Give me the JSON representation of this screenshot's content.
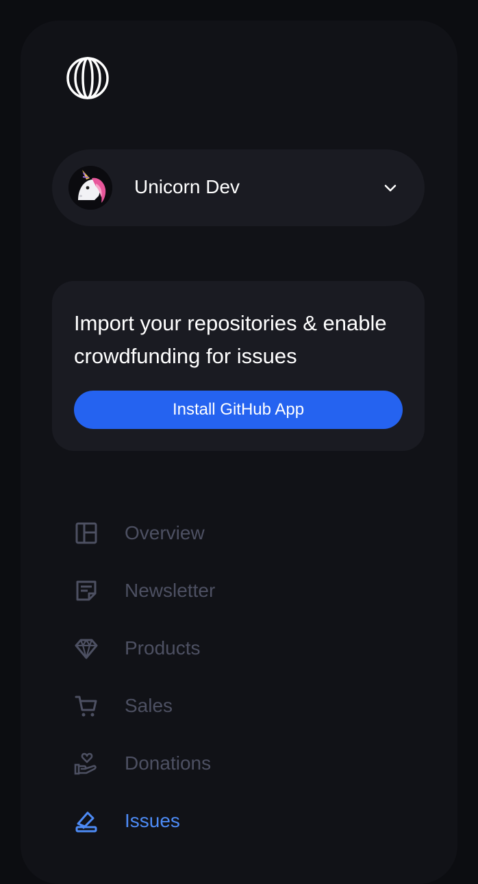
{
  "account": {
    "name": "Unicorn Dev",
    "avatar_icon": "unicorn-icon"
  },
  "promo": {
    "text": "Import your repositories & enable crowdfunding for issues",
    "button_label": "Install GitHub App"
  },
  "nav": {
    "items": [
      {
        "label": "Overview",
        "icon": "layout-icon",
        "active": false
      },
      {
        "label": "Newsletter",
        "icon": "newsletter-icon",
        "active": false
      },
      {
        "label": "Products",
        "icon": "diamond-icon",
        "active": false
      },
      {
        "label": "Sales",
        "icon": "cart-icon",
        "active": false
      },
      {
        "label": "Donations",
        "icon": "hand-heart-icon",
        "active": false
      },
      {
        "label": "Issues",
        "icon": "issues-icon",
        "active": true
      }
    ]
  },
  "colors": {
    "background": "#0c0d11",
    "panel": "#111217",
    "card": "#1a1b22",
    "accent": "#2563f0",
    "active_nav": "#4d8bf6",
    "inactive_nav": "#4d5062"
  }
}
